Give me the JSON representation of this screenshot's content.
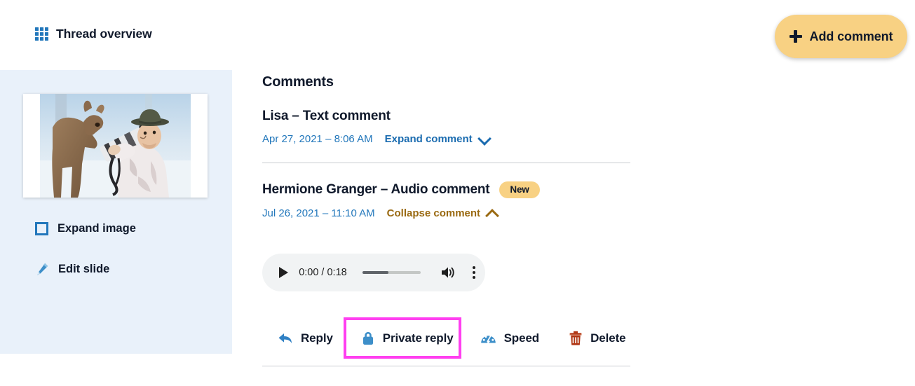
{
  "topbar": {
    "thread_overview_label": "Thread overview",
    "grid_icon": "grid-icon",
    "add_comment_label": "Add comment",
    "add_comment_icon": "plus-icon",
    "add_comment_bg": "#f8d183"
  },
  "sidebar": {
    "bg": "#e9f1fa",
    "slide_image_alt": "Deer touching a camera lens held by a photographer in snow",
    "actions": [
      {
        "label": "Expand image",
        "icon": "expand-icon"
      },
      {
        "label": "Edit slide",
        "icon": "pencil-icon"
      }
    ]
  },
  "main": {
    "heading": "Comments",
    "comments": [
      {
        "title": "Lisa – Text comment",
        "date": "Apr 27, 2021 – 8:06 AM",
        "toggle_label": "Expand comment",
        "toggle_state": "collapsed",
        "toggle_icon": "chevron-down-icon",
        "badge": null
      },
      {
        "title": "Hermione Granger – Audio comment",
        "date": "Jul 26, 2021 – 11:10 AM",
        "toggle_label": "Collapse comment",
        "toggle_state": "expanded",
        "toggle_icon": "chevron-up-icon",
        "badge": "New"
      }
    ],
    "audio": {
      "current_time": "0:00",
      "duration": "0:18",
      "time_display": "0:00 / 0:18",
      "progress_percent": 45,
      "play_icon": "play-icon",
      "volume_icon": "volume-icon",
      "menu_icon": "more-vertical-icon"
    },
    "actions": [
      {
        "label": "Reply",
        "icon": "reply-arrow-icon",
        "icon_color": "#2f80c4"
      },
      {
        "label": "Private reply",
        "icon": "lock-icon",
        "icon_color": "#3d8fc9"
      },
      {
        "label": "Speed",
        "icon": "speedometer-icon",
        "icon_color": "#3d8fc9"
      },
      {
        "label": "Delete",
        "icon": "trash-icon",
        "icon_color": "#b03513"
      }
    ],
    "highlight": {
      "target": "Private reply",
      "color": "#ff3ff0"
    }
  }
}
